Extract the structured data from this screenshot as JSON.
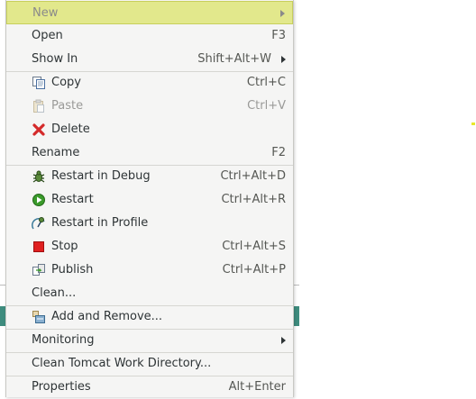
{
  "menu": {
    "new": {
      "label": "New"
    },
    "open": {
      "label": "Open",
      "shortcut": "F3"
    },
    "show_in": {
      "label": "Show In",
      "shortcut": "Shift+Alt+W"
    },
    "copy": {
      "label": "Copy",
      "shortcut": "Ctrl+C",
      "icon": "copy-icon"
    },
    "paste": {
      "label": "Paste",
      "shortcut": "Ctrl+V",
      "icon": "paste-icon"
    },
    "delete": {
      "label": "Delete",
      "icon": "delete-icon"
    },
    "rename": {
      "label": "Rename",
      "shortcut": "F2"
    },
    "restart_debug": {
      "label": "Restart in Debug",
      "shortcut": "Ctrl+Alt+D",
      "icon": "debug-icon"
    },
    "restart": {
      "label": "Restart",
      "shortcut": "Ctrl+Alt+R",
      "icon": "run-icon"
    },
    "restart_profile": {
      "label": "Restart in Profile",
      "icon": "profile-icon"
    },
    "stop": {
      "label": "Stop",
      "shortcut": "Ctrl+Alt+S",
      "icon": "stop-icon"
    },
    "publish": {
      "label": "Publish",
      "shortcut": "Ctrl+Alt+P",
      "icon": "publish-icon"
    },
    "clean": {
      "label": "Clean..."
    },
    "add_remove": {
      "label": "Add and Remove...",
      "icon": "add-remove-icon"
    },
    "monitoring": {
      "label": "Monitoring"
    },
    "clean_tomcat": {
      "label": "Clean Tomcat Work Directory..."
    },
    "properties": {
      "label": "Properties",
      "shortcut": "Alt+Enter"
    }
  },
  "colors": {
    "highlight": "#e2e88c",
    "menu_bg": "#f5f5f4",
    "stop_red": "#e02020",
    "delete_red": "#d42a2a",
    "run_green": "#3a9a2a"
  }
}
